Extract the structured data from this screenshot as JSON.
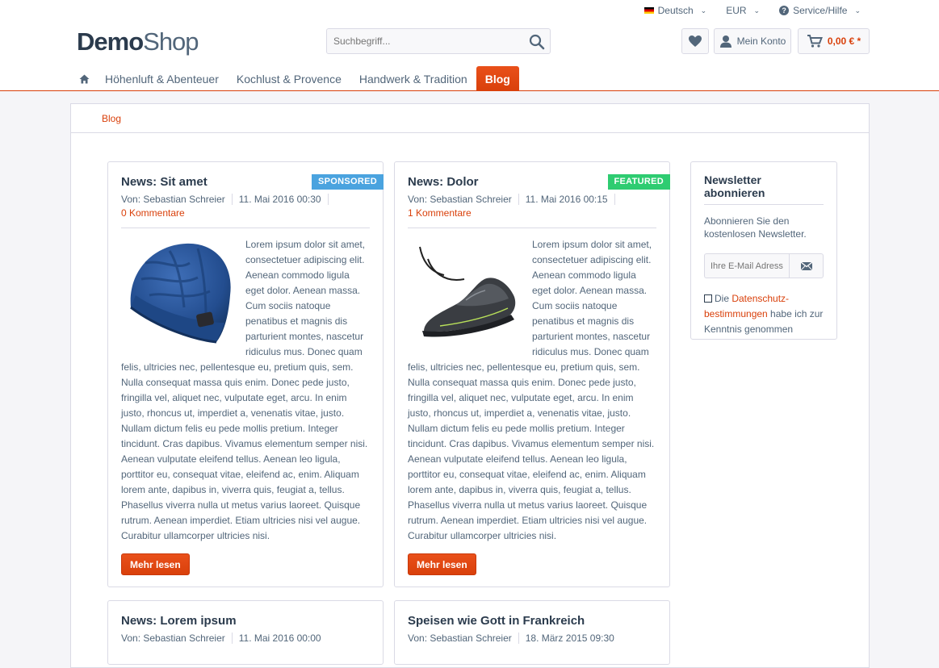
{
  "top_meta": {
    "language": "Deutsch",
    "currency": "EUR",
    "service": "Service/Hilfe"
  },
  "logo": {
    "part1": "Demo",
    "part2": "Shop"
  },
  "search": {
    "placeholder": "Suchbegriff..."
  },
  "header": {
    "account_label": "Mein Konto",
    "cart_price": "0,00 € *"
  },
  "nav": {
    "items": [
      {
        "label": "Höhenluft & Abenteuer"
      },
      {
        "label": "Kochlust & Provence"
      },
      {
        "label": "Handwerk & Tradition"
      },
      {
        "label": "Blog"
      }
    ]
  },
  "breadcrumb": "Blog",
  "posts": [
    {
      "title": "News: Sit amet",
      "badge": "SPONSORED",
      "author": "Von: Sebastian Schreier",
      "date": "11. Mai 2016 00:30",
      "comments": "0 Kommentare",
      "excerpt": "Lorem ipsum dolor sit amet, consectetuer adipiscing elit. Aenean commodo ligula eget dolor. Aenean massa. Cum sociis natoque penatibus et magnis dis parturient montes, nascetur ridiculus mus. Donec quam felis, ultricies nec, pellentesque eu, pretium quis, sem. Nulla consequat massa quis enim. Donec pede justo, fringilla vel, aliquet nec, vulputate eget, arcu. In enim justo, rhoncus ut, imperdiet a, venenatis vitae, justo. Nullam dictum felis eu pede mollis pretium. Integer tincidunt. Cras dapibus. Vivamus elementum semper nisi. Aenean vulputate eleifend tellus. Aenean leo ligula, porttitor eu, consequat vitae, eleifend ac, enim. Aliquam lorem ante, dapibus in, viverra quis, feugiat a, tellus. Phasellus viverra nulla ut metus varius laoreet. Quisque rutrum. Aenean imperdiet. Etiam ultricies nisi vel augue. Curabitur ullamcorper ultricies nisi.",
      "more": "Mehr lesen"
    },
    {
      "title": "News: Dolor",
      "badge": "FEATURED",
      "author": "Von: Sebastian Schreier",
      "date": "11. Mai 2016 00:15",
      "comments": "1 Kommentare",
      "excerpt": "Lorem ipsum dolor sit amet, consectetuer adipiscing elit. Aenean commodo ligula eget dolor. Aenean massa. Cum sociis natoque penatibus et magnis dis parturient montes, nascetur ridiculus mus. Donec quam felis, ultricies nec, pellentesque eu, pretium quis, sem. Nulla consequat massa quis enim. Donec pede justo, fringilla vel, aliquet nec, vulputate eget, arcu. In enim justo, rhoncus ut, imperdiet a, venenatis vitae, justo. Nullam dictum felis eu pede mollis pretium. Integer tincidunt. Cras dapibus. Vivamus elementum semper nisi. Aenean vulputate eleifend tellus. Aenean leo ligula, porttitor eu, consequat vitae, eleifend ac, enim. Aliquam lorem ante, dapibus in, viverra quis, feugiat a, tellus. Phasellus viverra nulla ut metus varius laoreet. Quisque rutrum. Aenean imperdiet. Etiam ultricies nisi vel augue. Curabitur ullamcorper ultricies nisi.",
      "more": "Mehr lesen"
    },
    {
      "title": "News: Lorem ipsum",
      "author": "Von: Sebastian Schreier",
      "date": "11. Mai 2016 00:00"
    },
    {
      "title": "Speisen wie Gott in Frankreich",
      "author": "Von: Sebastian Schreier",
      "date": "18. März 2015 09:30"
    }
  ],
  "newsletter": {
    "title": "Newsletter abonnieren",
    "text": "Abonnieren Sie den kostenlosen Newsletter.",
    "placeholder": "Ihre E-Mail Adresse",
    "consent_pre": "Die ",
    "consent_link": "Datenschutz-bestimmungen",
    "consent_post": " habe ich zur Kenntnis genommen"
  },
  "colors": {
    "accent": "#d9400b",
    "sponsored": "#4aa3df",
    "featured": "#2ecc71"
  }
}
